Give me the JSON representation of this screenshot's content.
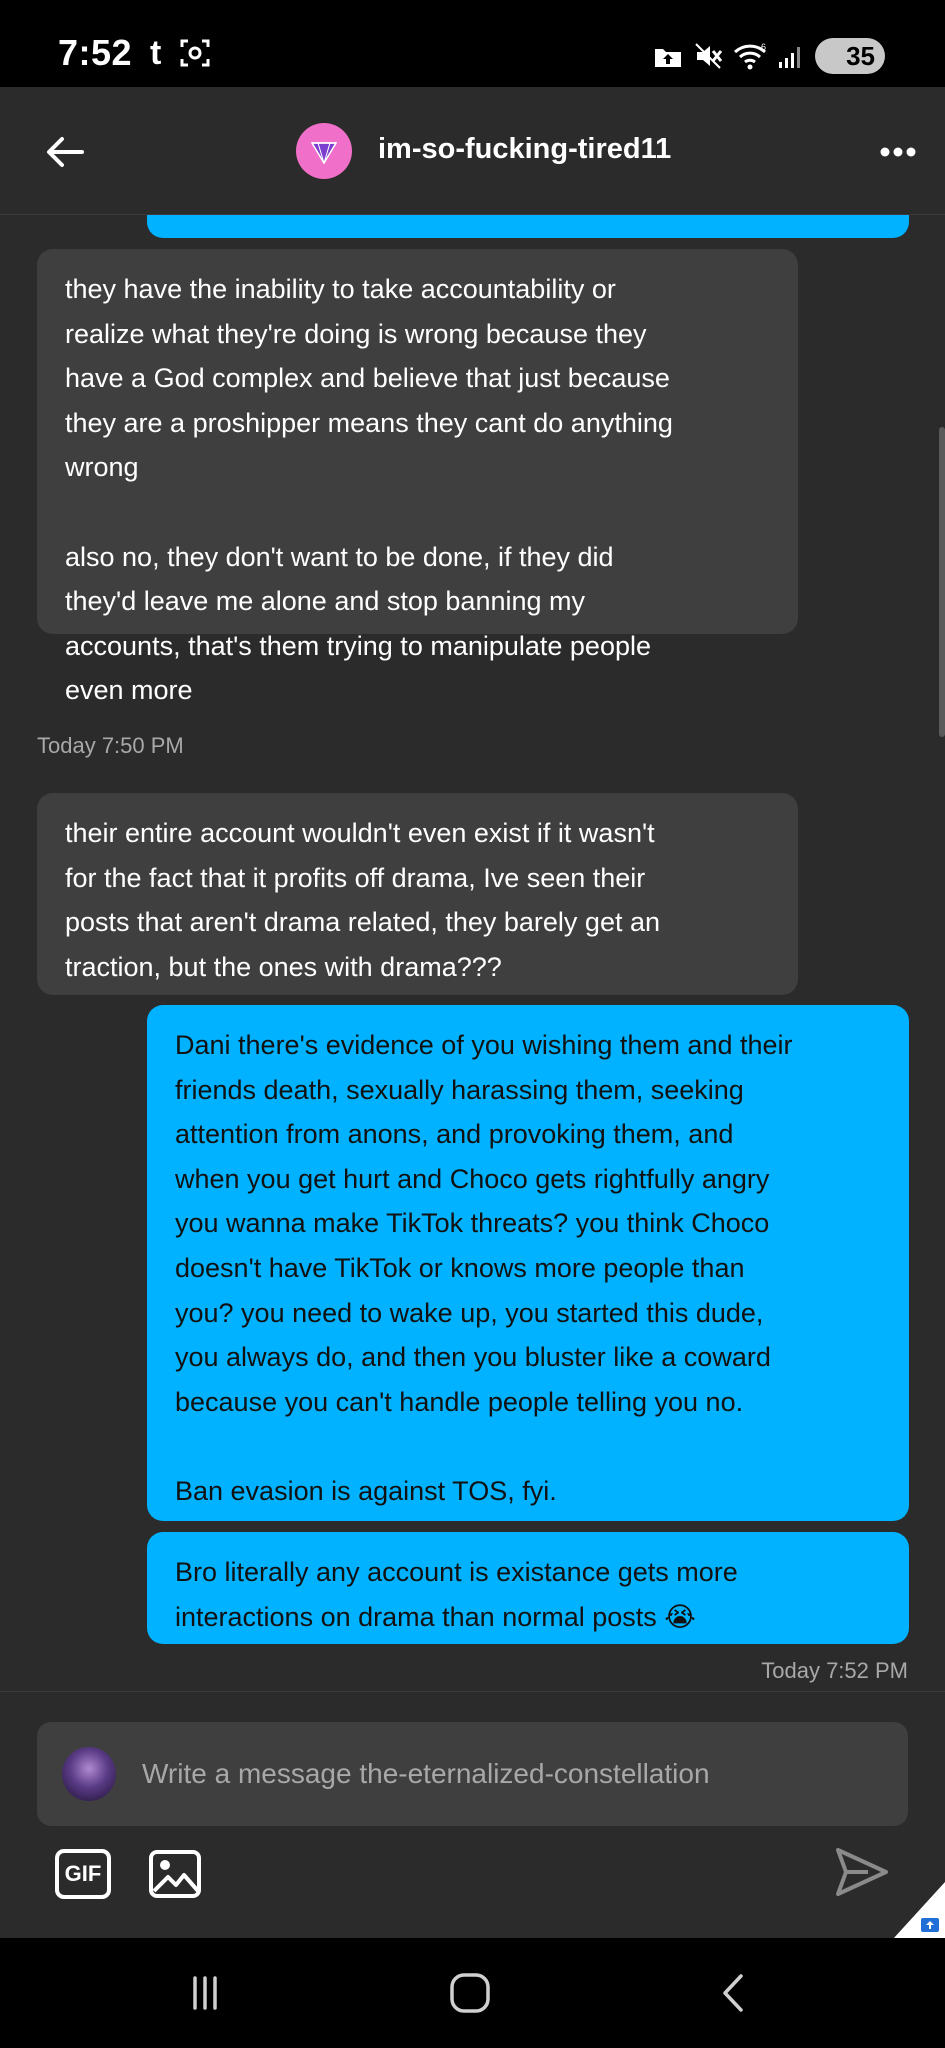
{
  "status_bar": {
    "time": "7:52",
    "left_icons": [
      "tumblr-t-icon",
      "screenshot-icon"
    ],
    "t_glyph": "t",
    "right_icons": [
      "upload-icon",
      "mute-icon",
      "wifi-icon",
      "signal-icon"
    ],
    "battery_level": "35"
  },
  "header": {
    "title": "im-so-fucking-tired11",
    "avatar_color": "#f06fc8",
    "back_icon": "arrow-left-icon",
    "menu_icon": "more-horizontal-icon"
  },
  "messages": [
    {
      "direction": "incoming",
      "text": "they have the inability to take accountability or\nrealize what they're doing is wrong because they\nhave a God complex and believe that just because\nthey are a proshipper means they cant do anything\nwrong\n\nalso no, they don't want to be done, if they did\nthey'd leave me alone and stop banning my\naccounts, that's them trying to manipulate people\neven more"
    },
    {
      "direction": "incoming",
      "text": "their entire account wouldn't even exist if it wasn't\nfor the fact that it profits off drama, Ive seen their\nposts that aren't drama related, they barely get an\ntraction, but the ones with drama???"
    },
    {
      "direction": "outgoing",
      "text": "Dani there's evidence of you wishing them and their\nfriends death, sexually harassing them, seeking\nattention from anons, and provoking them, and\nwhen you get hurt and Choco gets rightfully angry\nyou wanna make TikTok threats? you think Choco\ndoesn't have TikTok or knows more people than\nyou? you need to wake up, you started this dude,\nyou always do, and then you bluster like a coward\nbecause you can't handle people telling you no.\n\nBan evasion is against TOS, fyi."
    },
    {
      "direction": "outgoing",
      "text": "Bro literally any account is existance gets more\ninteractions on drama than normal posts 😭"
    }
  ],
  "timestamps": [
    "Today 7:50 PM",
    "Today 7:52 PM"
  ],
  "composer": {
    "placeholder": "Write a message the-eternalized-constellation",
    "gif_label": "GIF",
    "image_icon": "image-icon",
    "send_icon": "send-icon"
  },
  "nav_bar": {
    "icons": [
      "recent-apps-icon",
      "home-icon",
      "back-icon"
    ]
  },
  "colors": {
    "outgoing_bubble": "#00b2ff",
    "incoming_bubble": "#3f3f3f",
    "background": "#2b2b2b"
  }
}
